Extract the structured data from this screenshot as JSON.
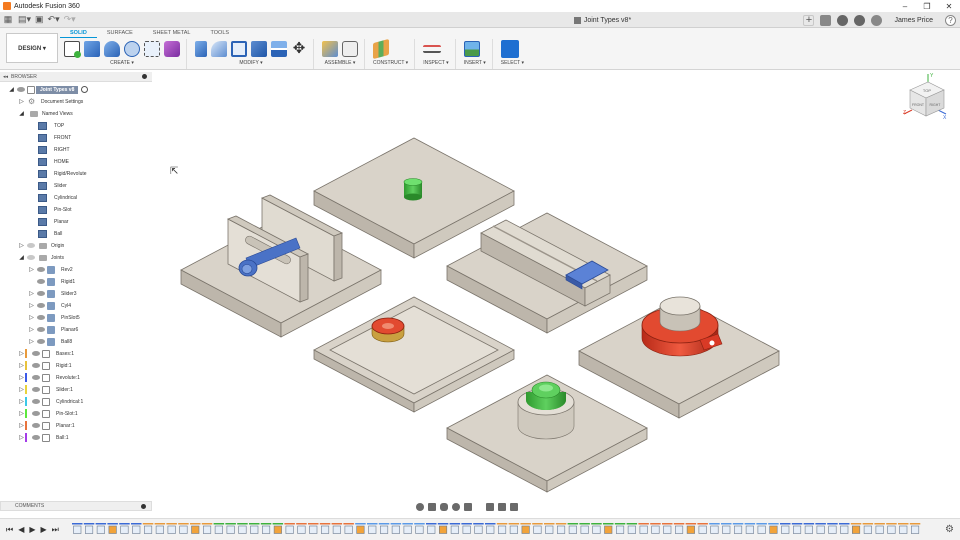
{
  "titlebar": {
    "app_title": "Autodesk Fusion 360",
    "minimize": "–",
    "maximize": "❐",
    "close": "✕"
  },
  "qat": {
    "document_title": "Joint Types v8*",
    "doc_close": "✕",
    "user_name": "James Price",
    "plus": "+"
  },
  "ribbon": {
    "workspace": "DESIGN ▾",
    "tabs": [
      "SOLID",
      "SURFACE",
      "SHEET METAL",
      "TOOLS"
    ],
    "active_tab": "SOLID",
    "groups": [
      {
        "label": "CREATE ▾"
      },
      {
        "label": "MODIFY ▾"
      },
      {
        "label": "ASSEMBLE ▾"
      },
      {
        "label": "CONSTRUCT ▾"
      },
      {
        "label": "INSPECT ▾"
      },
      {
        "label": "INSERT ▾"
      },
      {
        "label": "SELECT ▾"
      }
    ]
  },
  "browser": {
    "header": "BROWSER",
    "root": "Joint Types v8",
    "items": [
      {
        "label": "Document Settings"
      },
      {
        "label": "Named Views"
      },
      {
        "label": "TOP"
      },
      {
        "label": "FRONT"
      },
      {
        "label": "RIGHT"
      },
      {
        "label": "HOME"
      },
      {
        "label": "Rigid/Revolute"
      },
      {
        "label": "Slider"
      },
      {
        "label": "Cylindrical"
      },
      {
        "label": "Pin-Slot"
      },
      {
        "label": "Planar"
      },
      {
        "label": "Ball"
      },
      {
        "label": "Origin"
      },
      {
        "label": "Joints"
      },
      {
        "label": "Rev2"
      },
      {
        "label": "Rigid1"
      },
      {
        "label": "Slider3"
      },
      {
        "label": "Cyl4"
      },
      {
        "label": "PinSlot5"
      },
      {
        "label": "Planar6"
      },
      {
        "label": "Ball8"
      },
      {
        "label": "Bases:1"
      },
      {
        "label": "Rigid:1"
      },
      {
        "label": "Revolute:1"
      },
      {
        "label": "Slider:1"
      },
      {
        "label": "Cylindrical:1"
      },
      {
        "label": "Pin-Slot:1"
      },
      {
        "label": "Planar:1"
      },
      {
        "label": "Ball:1"
      }
    ]
  },
  "comments": {
    "label": "COMMENTS"
  },
  "viewcube": {
    "top": "TOP",
    "front": "FRONT",
    "right": "RIGHT",
    "x": "X",
    "y": "Y",
    "z": "Z"
  },
  "colors": {
    "accent": "#0696d7",
    "plate": "#d9d3c9",
    "plate_edge": "#a69e93",
    "green": "#3db23d",
    "red": "#d93a26",
    "blue": "#4a72c6"
  }
}
